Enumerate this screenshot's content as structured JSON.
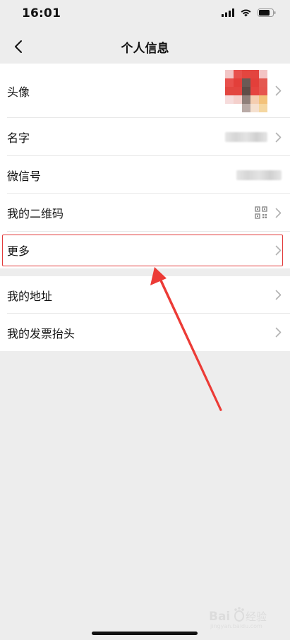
{
  "status_bar": {
    "time": "16:01"
  },
  "nav": {
    "title": "个人信息"
  },
  "profile_rows": [
    {
      "label": "头像",
      "value_kind": "avatar"
    },
    {
      "label": "名字",
      "value_kind": "blurred-text"
    },
    {
      "label": "微信号",
      "value_kind": "blurred-text"
    },
    {
      "label": "我的二维码",
      "value_kind": "qr-icon"
    },
    {
      "label": "更多",
      "value_kind": "none"
    }
  ],
  "other_rows": [
    {
      "label": "我的地址"
    },
    {
      "label": "我的发票抬头"
    }
  ],
  "annotation": {
    "highlight_color": "#e23b3b",
    "highlighted_row": "更多"
  },
  "colors": {
    "page_bg": "#ededed",
    "row_bg": "#ffffff",
    "chevron": "#b2b2b2"
  },
  "avatar_colors": [
    [
      "#f2c6c6",
      "#e8504c",
      "#e4463f",
      "#e3443f",
      "#f3c4c4"
    ],
    [
      "#e8504c",
      "#e33f3a",
      "#6b5a55",
      "#e33f3a",
      "#e45850"
    ],
    [
      "#e24640",
      "#e34540",
      "#5f4d48",
      "#e5443f",
      "#e6554d"
    ],
    [
      "#f6dcdc",
      "#f4d0cc",
      "#8f7f7a",
      "#f4cdb0",
      "#f3c27a"
    ],
    [
      "#ffffff",
      "#ffffff",
      "#b9aaa6",
      "#f5e0cf",
      "#f5d7a0"
    ]
  ]
}
